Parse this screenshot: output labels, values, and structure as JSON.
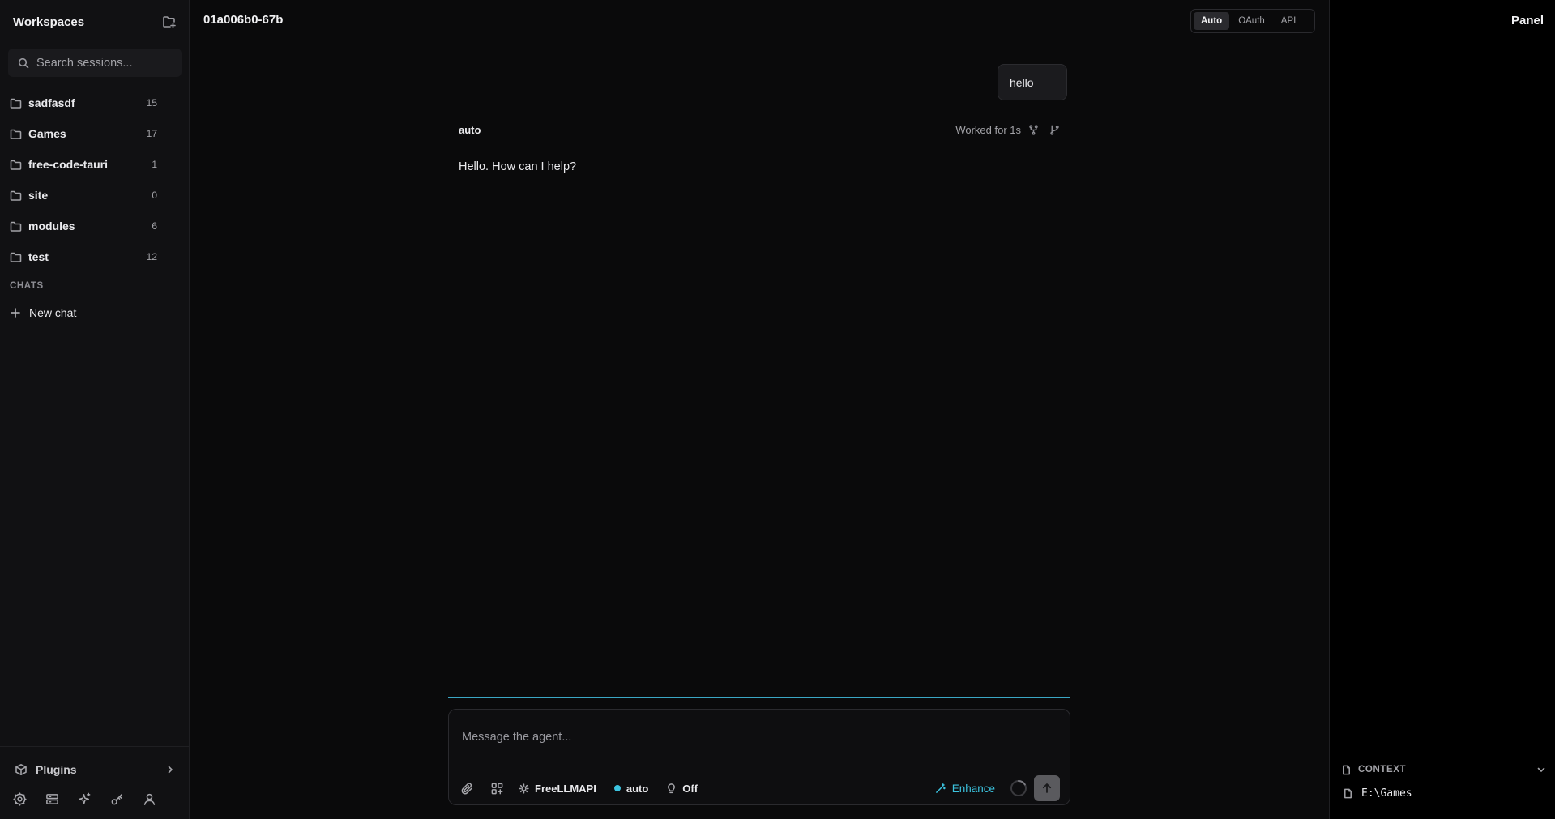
{
  "sidebar": {
    "title": "Workspaces",
    "search_placeholder": "Search sessions...",
    "workspaces": [
      {
        "name": "sadfasdf",
        "count": "15"
      },
      {
        "name": "Games",
        "count": "17"
      },
      {
        "name": "free-code-tauri",
        "count": "1"
      },
      {
        "name": "site",
        "count": "0"
      },
      {
        "name": "modules",
        "count": "6"
      },
      {
        "name": "test",
        "count": "12"
      }
    ],
    "chats_label": "CHATS",
    "new_chat_label": "New chat",
    "plugins_label": "Plugins"
  },
  "topbar": {
    "session_id": "01a006b0-67b",
    "modes": [
      {
        "label": "Auto",
        "active": true
      },
      {
        "label": "OAuth",
        "active": false
      },
      {
        "label": "API",
        "active": false
      }
    ]
  },
  "conversation": {
    "user_message": "hello",
    "agent_name": "auto",
    "worked_for": "Worked for 1s",
    "agent_message": "Hello. How can I help?"
  },
  "composer": {
    "placeholder": "Message the agent...",
    "provider_label": "FreeLLMAPI",
    "model_label": "auto",
    "model_dot_color": "#3cc4e0",
    "thinking_label": "Off",
    "enhance_label": "Enhance",
    "accent_color": "#3aa6c4"
  },
  "panel": {
    "title": "Panel",
    "context_label": "CONTEXT",
    "context_items": [
      "E:\\Games"
    ]
  }
}
